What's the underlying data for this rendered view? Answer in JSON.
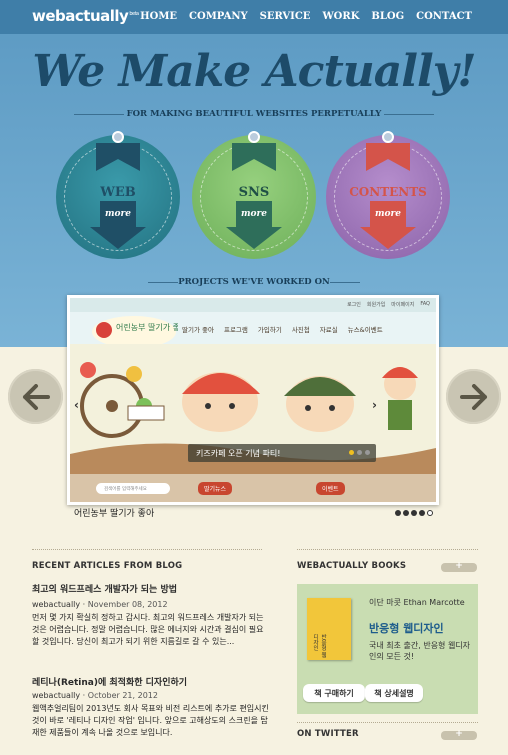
{
  "header": {
    "logo": "webactually",
    "logo_sup": "beta",
    "nav": [
      "HOME",
      "COMPANY",
      "SERVICE",
      "WORK",
      "BLOG",
      "CONTACT"
    ]
  },
  "hero": {
    "headline": "We Make Actually!",
    "tagline": "FOR MAKING BEAUTIFUL WEBSITES PERPETUALLY",
    "badges": [
      {
        "label": "WEB",
        "more": "more",
        "color": "#2f7f8f"
      },
      {
        "label": "SNS",
        "more": "more",
        "color": "#7fbf6a"
      },
      {
        "label": "CONTENTS",
        "more": "more",
        "color": "#9a72b6"
      }
    ]
  },
  "projects": {
    "heading": "PROJECTS WE'VE WORKED ON",
    "slide_title": "어린농부 딸기가 좋아",
    "caption": "키즈카페 오픈 기념 파티!",
    "site_links": [
      "로그인",
      "회원가입",
      "마이페이지",
      "FAQ"
    ],
    "site_menu": [
      "딸기가 좋아",
      "프로그램",
      "가입하기",
      "사진첩",
      "자료실",
      "뉴스&이벤트"
    ],
    "site_logo": "어린농부 딸기가 좋아",
    "search_placeholder": "검색어를 입력해주세요",
    "bottom_tabs": [
      "딸기뉴스",
      "이벤트"
    ],
    "pager_total": 5,
    "pager_active": 4
  },
  "blog": {
    "heading": "RECENT ARTICLES FROM BLOG",
    "articles": [
      {
        "title": "최고의 워드프레스 개발자가 되는 방법",
        "author": "webactually",
        "date": "November 08, 2012",
        "body": "먼저 몇 가지 확실히 정하고 갑시다. 최고의 워드프레스 개발자가 되는 것은 어렵습니다. 정말 어렵습니다. 많은 에너지와 시간과 결심이 필요할 것입니다. 당신이 최고가 되기 위한 지름길로 갈 수 있는..."
      },
      {
        "title": "레티나(Retina)에 최적화한 디자인하기",
        "author": "webactually",
        "date": "October 21, 2012",
        "body": "웹액추얼리팀이 2013년도 회사 목표와 비전 리스트에 추가로 편입시킨 것이 바로 '레티나 디자인 작업' 입니다. 앞으로 고해상도의 스크린을 탑재한 제품들이 계속 나올 것으로 보입니다."
      }
    ]
  },
  "books": {
    "heading": "WEBACTUALLY BOOKS",
    "plus": "+",
    "author": "이단 마콧 Ethan Marcotte",
    "title": "반응형 웹디자인",
    "description": "국내 최초 출간, 반응형 웹디자인의 모든 것!",
    "cover_text": "반응형 웹디자인",
    "buy_button": "책 구매하기",
    "detail_button": "책 상세설명"
  },
  "twitter": {
    "heading": "ON TWITTER",
    "plus": "+"
  },
  "colors": {
    "hero_blue": "#6aa6cc",
    "navy": "#1d4b69",
    "cream": "#f6f2e1"
  }
}
